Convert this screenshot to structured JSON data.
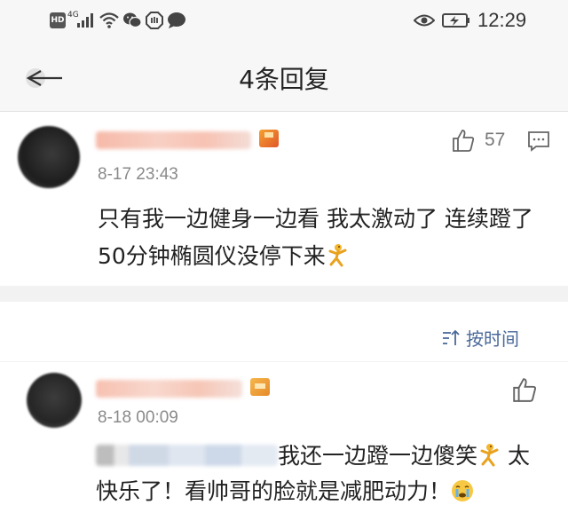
{
  "status_bar": {
    "network_badge": "HD",
    "network_type": "4G",
    "time": "12:29",
    "icons": [
      "signal-icon",
      "wifi-icon",
      "wechat-icon",
      "stop-hand-icon",
      "message-icon",
      "eye-comfort-icon",
      "battery-charging-icon"
    ]
  },
  "nav": {
    "title": "4条回复",
    "back_icon": "back-arrow-icon"
  },
  "main_comment": {
    "timestamp": "8-17 23:43",
    "likes": "57",
    "text": "只有我一边健身一边看 我太激动了 连续蹬了50分钟椭圆仪没停下来",
    "emoji": "dancing-emoji"
  },
  "replies_section": {
    "sort_label": "按时间",
    "sort_icon": "sort-icon"
  },
  "reply": {
    "timestamp": "8-18 00:09",
    "text_part1": "我还一边蹬一边傻笑",
    "text_part2": " 太快乐了！看帅哥的脸就是减肥动力！",
    "emoji1": "dancing-emoji",
    "emoji2": "crying-emoji"
  },
  "colors": {
    "link_blue": "#4a6a9a",
    "muted_gray": "#8a8a8a",
    "separator": "#f2f2f2"
  }
}
